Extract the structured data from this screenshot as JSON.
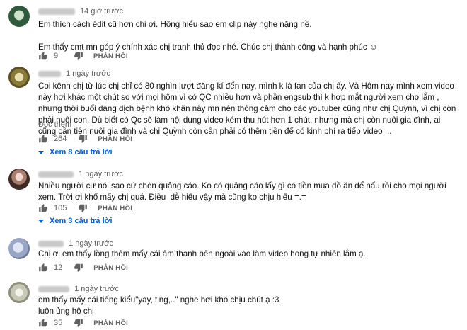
{
  "colors": {
    "link": "#065fd4",
    "muted": "#606060",
    "text": "#0f0f0f"
  },
  "icons": {
    "like": "thumb-up-icon",
    "dislike": "thumb-down-icon",
    "expand": "caret-down-icon"
  },
  "comments": [
    {
      "time": "14 giờ trước",
      "text": "Em thích cách édit cũ hơn chị ơi. Hông hiểu sao em clip này nghe nặng nề.\n\nEm thấy cmt mn góp ý chính xác chị tranh thủ đọc nhé. Chúc chị thành công và hạnh phúc ☺",
      "likes": "9",
      "reply_label": "PHẢN HỒI"
    },
    {
      "time": "1 ngày trước",
      "text": "Coi kênh chị từ lúc chị chỉ có 80 nghìn lượt đăng kí đến nay, mình k là fan của chị ấy. Và Hôm nay mình xem video này hơi khác một chút so với mọi hôm vì có QC nhiều hơn và phần engsub thì k hợp mắt người xem cho lắm , nhưng thời buổi đang dịch bệnh khó khăn này mn nên thông cảm cho các youtuber cũng như chị Quỳnh, vì chị còn phải nuôi con. Dù biết có Qc sẽ làm nội dung video kém thu hút hơn 1 chút, nhưng mà chị còn nuôi gia đình, ai cũng cần tiền nuôi gia đình và chị Quỳnh còn cần phải có thêm tiền để có kinh phí ra tiếp video ...",
      "read_more": "Đọc thêm",
      "likes": "264",
      "reply_label": "PHẢN HỒI",
      "view_replies": "Xem 8 câu trả lời"
    },
    {
      "time": "1 ngày trước",
      "text": "Nhiều người cứ nói sao cứ chèn quảng cáo. Ko có quảng cáo lấy gì có tiền mua đồ ăn để nấu rồi cho mọi người xem. Trời ơi khổ mấy chị quá. Điều  dễ hiểu vậy mà cũng ko chịu hiểu =.=",
      "likes": "105",
      "reply_label": "PHẢN HỒI",
      "view_replies": "Xem 3 câu trả lời"
    },
    {
      "time": "1 ngày trước",
      "text": "Chị ơi em thấy lồng thêm mấy cái âm thanh bên ngoài vào làm video hong tự nhiên lắm ạ.",
      "likes": "12",
      "reply_label": "PHẢN HỒI"
    },
    {
      "time": "1 ngày trước",
      "text": "em thấy mấy cái tiếng kiểu\"yay, ting,..\" nghe hơi khó chịu chút ạ :3\nluôn ủng hộ chị",
      "likes": "35",
      "reply_label": "PHẢN HỒI"
    }
  ]
}
